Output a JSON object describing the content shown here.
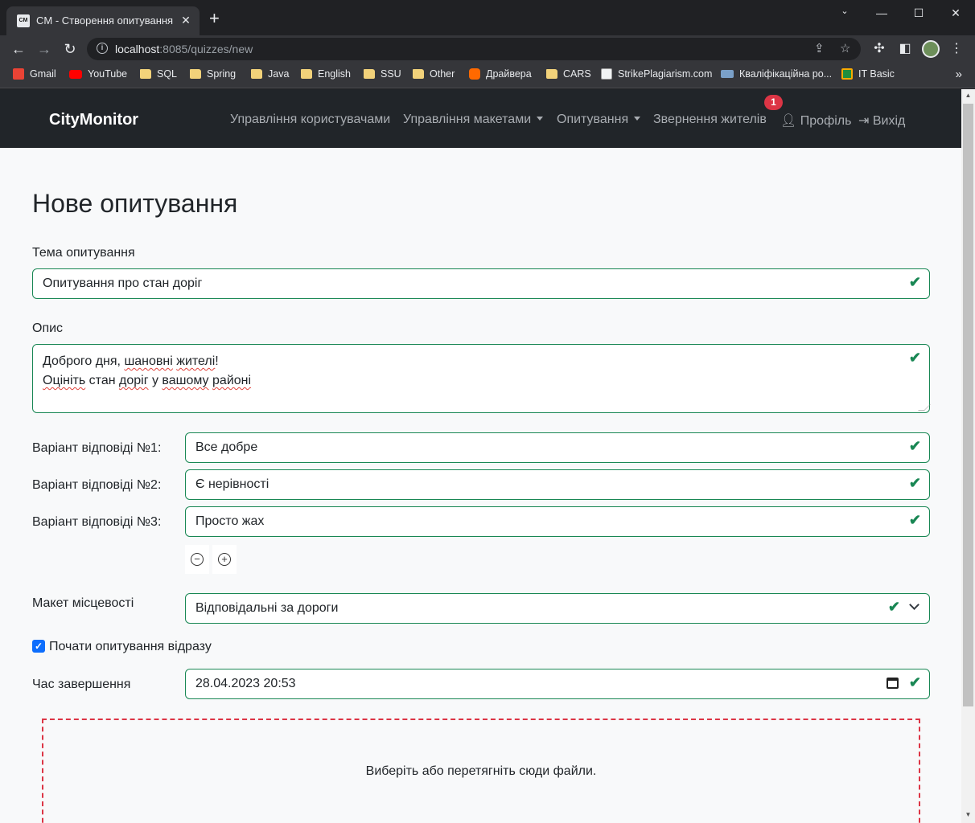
{
  "browser": {
    "tab_favicon": "CM",
    "tab_title": "CM - Створення опитування",
    "url_host": "localhost",
    "url_rest": ":8085/quizzes/new",
    "bookmarks": [
      {
        "label": "Gmail",
        "icon": "gmail-icon",
        "color": "#ea4335"
      },
      {
        "label": "YouTube",
        "icon": "youtube-icon",
        "color": "#ff0000"
      },
      {
        "label": "SQL",
        "icon": "folder-icon"
      },
      {
        "label": "Spring",
        "icon": "folder-icon"
      },
      {
        "label": "Java",
        "icon": "folder-icon"
      },
      {
        "label": "English",
        "icon": "folder-icon"
      },
      {
        "label": "SSU",
        "icon": "folder-icon"
      },
      {
        "label": "Other",
        "icon": "folder-icon"
      },
      {
        "label": "Драйвера",
        "icon": "mi-icon",
        "color": "#ff6900"
      },
      {
        "label": "CARS",
        "icon": "folder-icon"
      },
      {
        "label": "StrikePlagiarism.com",
        "icon": "document-icon"
      },
      {
        "label": "Кваліфікаційна ро...",
        "icon": "presentation-icon"
      },
      {
        "label": "IT Basic",
        "icon": "classroom-icon",
        "color": "#1e8e3e"
      }
    ]
  },
  "navbar": {
    "brand": "CityMonitor",
    "links": {
      "users": "Управління користувачами",
      "layouts": "Управління макетами",
      "quizzes": "Опитування",
      "appeals": "Звернення жителів",
      "profile": "Профіль",
      "logout": "Вихід"
    },
    "notification_count": "1"
  },
  "form": {
    "title": "Нове опитування",
    "topic_label": "Тема опитування",
    "topic_value": "Опитування про стан доріг",
    "description_label": "Опис",
    "description_line1_a": "Доброго дня, ",
    "description_line1_b": "шановні",
    "description_line1_c": " ",
    "description_line1_d": "жителі",
    "description_line1_e": "!",
    "description_line2_a": "Оцініть",
    "description_line2_b": " стан ",
    "description_line2_c": "доріг",
    "description_line2_d": " у ",
    "description_line2_e": "вашому",
    "description_line2_f": " ",
    "description_line2_g": "районі",
    "answers": [
      {
        "label": "Варіант відповіді №1:",
        "value": "Все добре"
      },
      {
        "label": "Варіант відповіді №2:",
        "value": "Є нерівності"
      },
      {
        "label": "Варіант відповіді №3:",
        "value": "Просто жах"
      }
    ],
    "layout_label": "Макет місцевості",
    "layout_value": "Відповідальні за дороги",
    "start_now_label": "Почати опитування відразу",
    "start_now_checked": true,
    "end_time_label": "Час завершення",
    "end_time_value": "28.04.2023 20:53",
    "dropzone_text": "Виберіть або перетягніть сюди файли."
  },
  "colors": {
    "valid": "#198754",
    "navbar_bg": "#212529",
    "badge": "#dc3545",
    "dropzone_border": "#dc3545",
    "checkbox": "#0d6efd"
  }
}
